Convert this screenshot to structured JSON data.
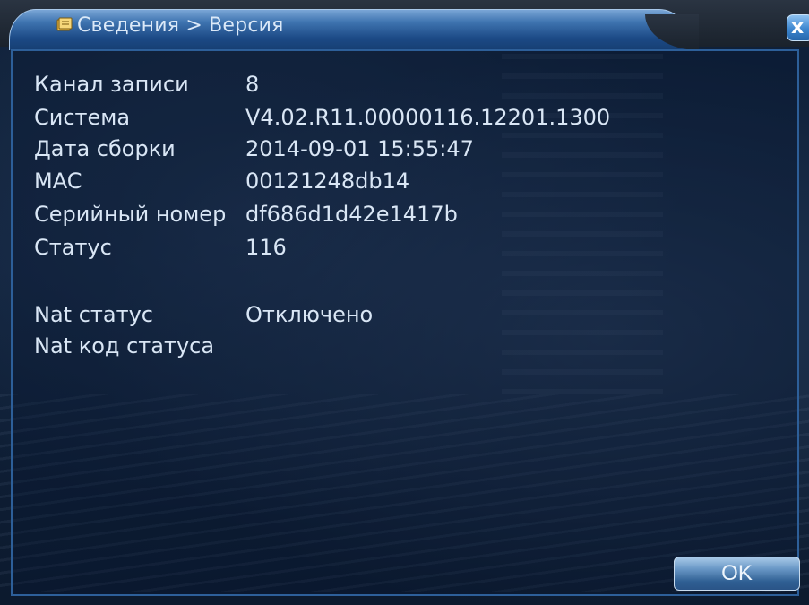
{
  "window": {
    "breadcrumb": "Сведения > Версия",
    "title_icon": "info-book-icon",
    "close_icon": "close-icon",
    "close_label": "x"
  },
  "info": {
    "rows": [
      {
        "label": "Канал записи",
        "value": "8"
      },
      {
        "label": "Система",
        "value": "V4.02.R11.00000116.12201.1300"
      },
      {
        "label": "Дата сборки",
        "value": "2014-09-01 15:55:47"
      },
      {
        "label": "MAC",
        "value": "00121248db14"
      },
      {
        "label": "Серийный номер",
        "value": "df686d1d42e1417b"
      },
      {
        "label": "Статус",
        "value": "116"
      },
      {
        "label": "Nat статус",
        "value": "Отключено"
      },
      {
        "label": "Nat код статуса",
        "value": ""
      }
    ]
  },
  "buttons": {
    "ok_label": "OK"
  },
  "colors": {
    "accent": "#3f74b0",
    "text": "#d9e6f5",
    "frame": "#2d5f99"
  }
}
